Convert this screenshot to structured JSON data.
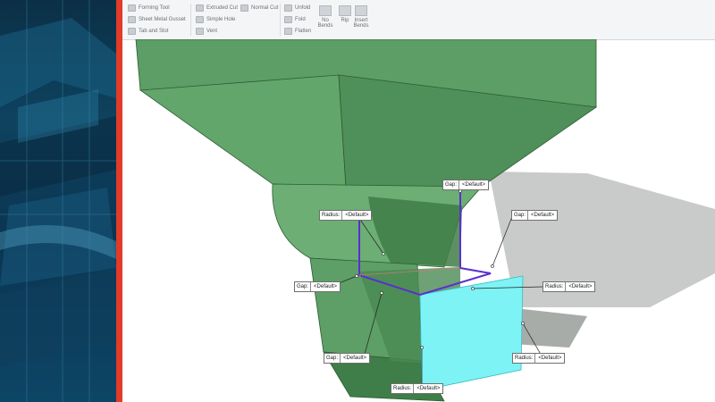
{
  "ribbon": {
    "group1": [
      "Forming Tool",
      "Sheet Metal Gusset",
      "Tab and Slot"
    ],
    "group2": [
      "Extruded Cut",
      "Simple Hole",
      "Vent"
    ],
    "group3": [
      "Normal Cut"
    ],
    "group4": [
      "Unfold",
      "Fold",
      "Flatten"
    ],
    "no_bends": "No Bends",
    "rip": "Rip",
    "insert_bends": "Insert Bends"
  },
  "callouts": [
    {
      "key": "Gap:",
      "value": "<Default>"
    },
    {
      "key": "Radius:",
      "value": "<Default>"
    },
    {
      "key": "Gap:",
      "value": "<Default>"
    },
    {
      "key": "Gap:",
      "value": "<Default>"
    },
    {
      "key": "Radius:",
      "value": "<Default>"
    },
    {
      "key": "Gap:",
      "value": "<Default>"
    },
    {
      "key": "Radius:",
      "value": "<Default>"
    },
    {
      "key": "Radius:",
      "value": "<Default>"
    }
  ],
  "colors": {
    "accent_red": "#e23b2a",
    "model_green": "#66a970",
    "selected_face": "#7df3f5",
    "edge_purple": "#5a2fd0"
  }
}
